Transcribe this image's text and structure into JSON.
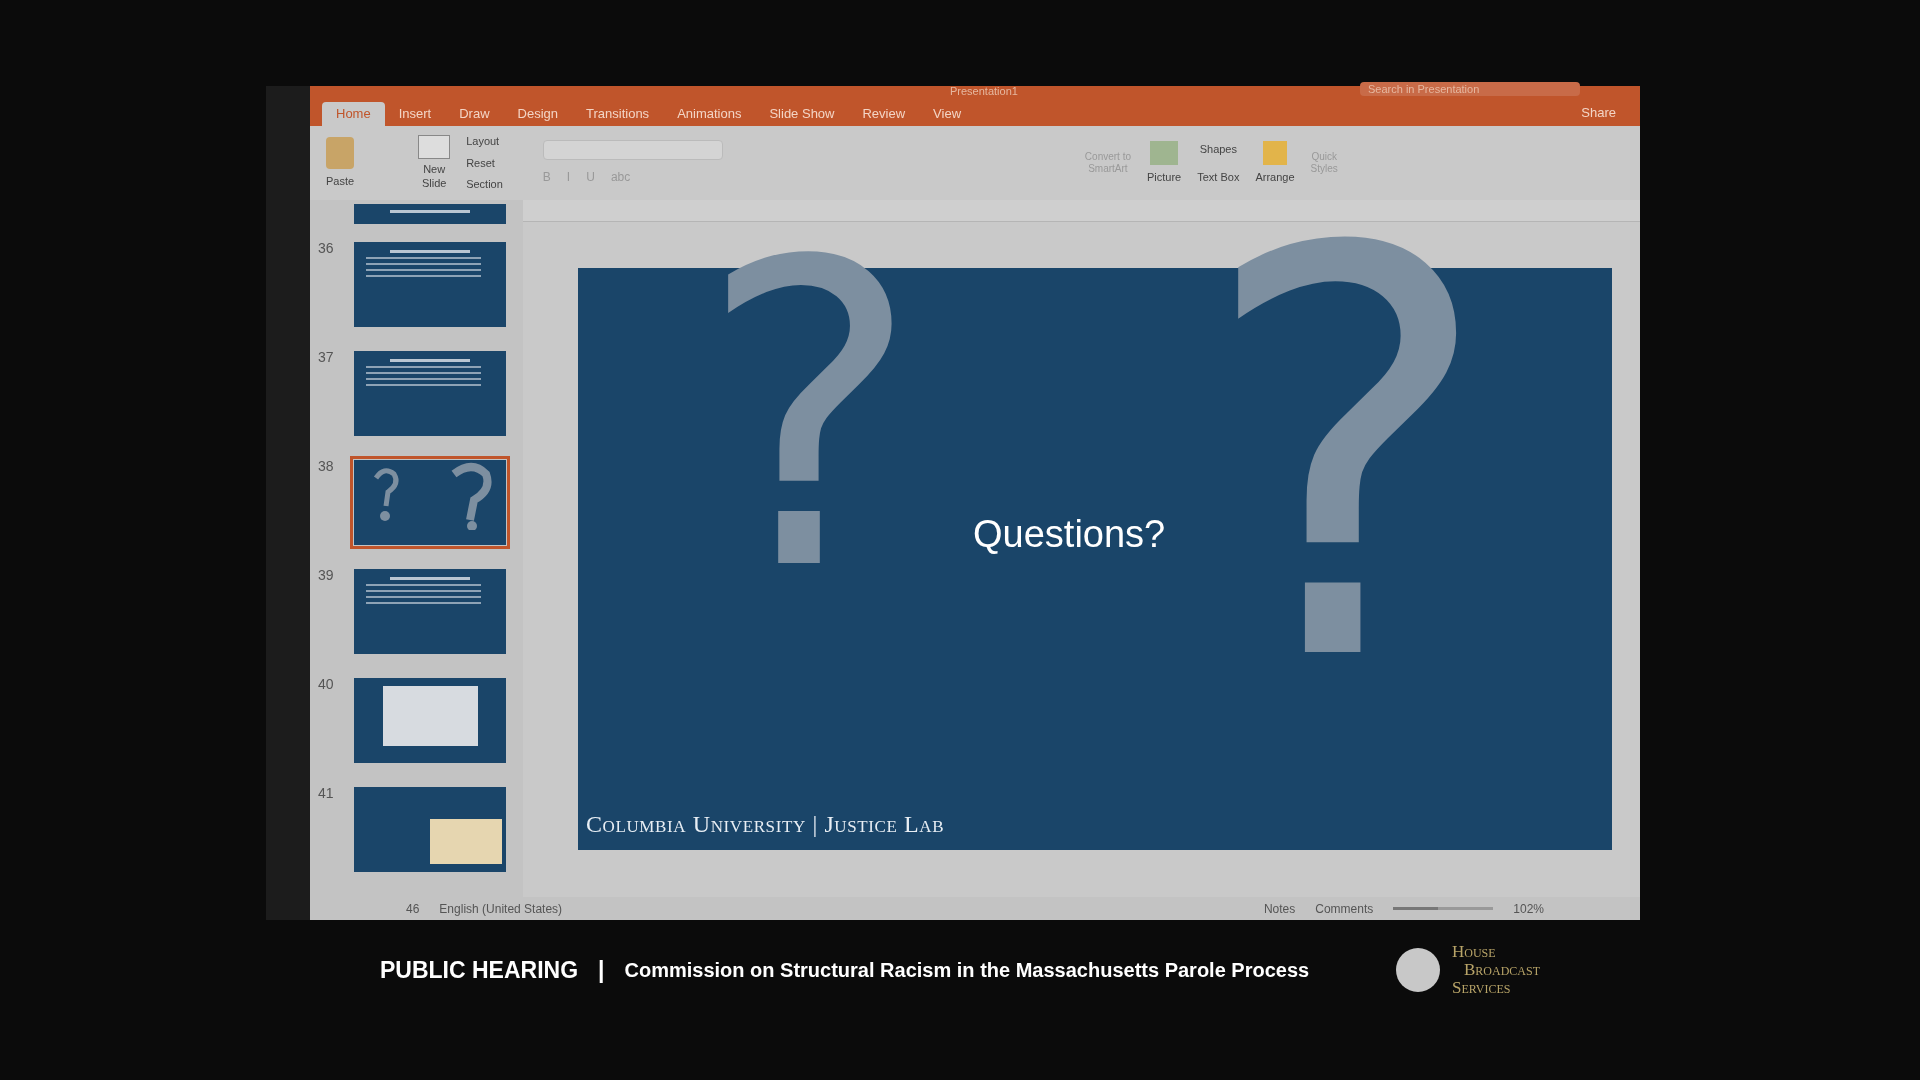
{
  "window": {
    "title": "Presentation1",
    "search": {
      "placeholder": "Search in Presentation"
    }
  },
  "tabs": [
    {
      "label": "Home",
      "selected": true
    },
    {
      "label": "Insert",
      "selected": false
    },
    {
      "label": "Draw",
      "selected": false
    },
    {
      "label": "Design",
      "selected": false
    },
    {
      "label": "Transitions",
      "selected": false
    },
    {
      "label": "Animations",
      "selected": false
    },
    {
      "label": "Slide Show",
      "selected": false
    },
    {
      "label": "Review",
      "selected": false
    },
    {
      "label": "View",
      "selected": false
    }
  ],
  "share": "Share",
  "ribbon": {
    "paste": "Paste",
    "new_slide": "New\nSlide",
    "layout": "Layout",
    "reset": "Reset",
    "section": "Section",
    "format_buttons": [
      "B",
      "I",
      "U",
      "abc"
    ],
    "convert": "Convert to\nSmartArt",
    "picture": "Picture",
    "shapes": "Shapes",
    "text_box": "Text Box",
    "arrange": "Arrange",
    "quick_styles": "Quick\nStyles"
  },
  "thumbnails": [
    {
      "kind": "strip",
      "selected": false
    },
    {
      "number": "36",
      "kind": "text",
      "selected": false
    },
    {
      "number": "37",
      "kind": "text",
      "selected": false
    },
    {
      "number": "38",
      "kind": "questions",
      "selected": true
    },
    {
      "number": "39",
      "kind": "text",
      "selected": false
    },
    {
      "number": "40",
      "kind": "map",
      "selected": false
    },
    {
      "number": "41",
      "kind": "usmap",
      "selected": false
    }
  ],
  "slide": {
    "marks": [
      "?",
      "?"
    ],
    "title": "Questions?",
    "footer": "Columbia University | Justice Lab"
  },
  "status_bar": {
    "slide_count": "46",
    "language": "English (United States)",
    "notes": "Notes",
    "comments": "Comments",
    "zoom": "102%",
    "level": 0.45
  },
  "caption": {
    "title": "PUBLIC HEARING",
    "separator": "|",
    "subtitle": "Commission on Structural Racism in the Massachusetts Parole Process",
    "logo_lines": [
      "House",
      "Broadcast",
      "Services"
    ]
  }
}
